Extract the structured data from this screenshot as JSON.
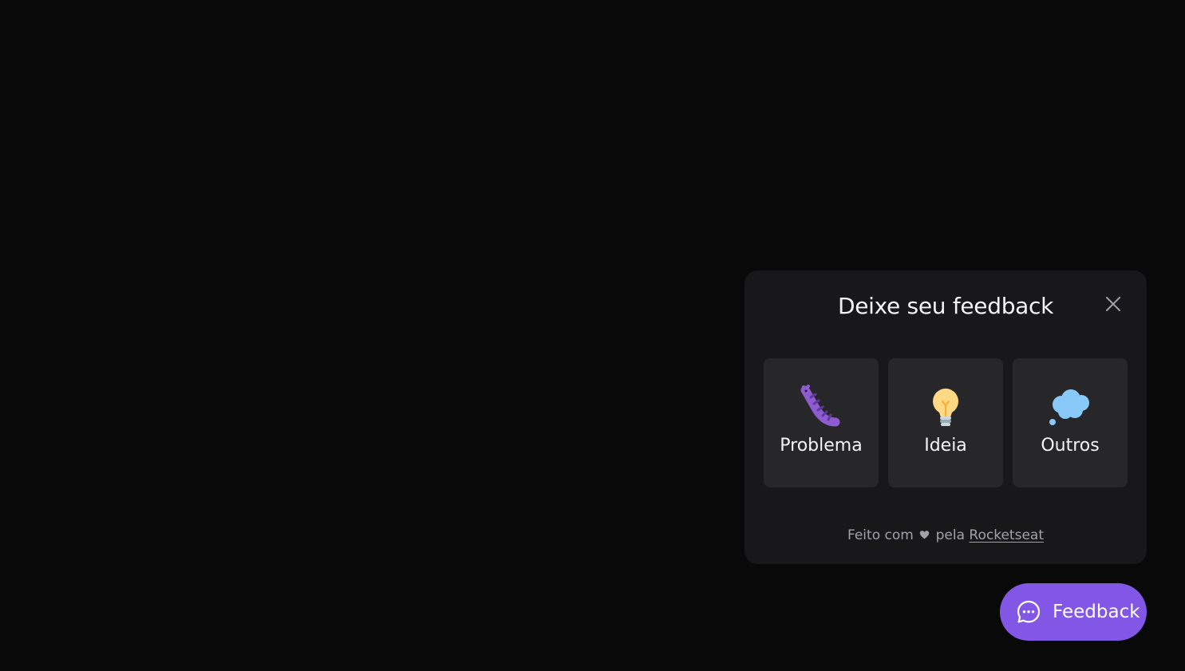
{
  "widget": {
    "title": "Deixe seu feedback",
    "close_icon": "close-icon",
    "options": [
      {
        "label": "Problema",
        "icon": "bug-icon"
      },
      {
        "label": "Ideia",
        "icon": "lightbulb-icon"
      },
      {
        "label": "Outros",
        "icon": "thought-balloon-icon"
      }
    ],
    "footer": {
      "prefix": "Feito com",
      "heart_icon": "heart-icon",
      "middle": "pela",
      "link": "Rocketseat"
    }
  },
  "feedback_button": {
    "label": "Feedback",
    "icon": "chat-bubble-icon"
  },
  "colors": {
    "background": "#09090a",
    "panel": "#18181b",
    "option_card": "#27272a",
    "brand": "#8257e5",
    "text_primary": "#f4f4f5",
    "text_muted": "#a1a1aa"
  }
}
